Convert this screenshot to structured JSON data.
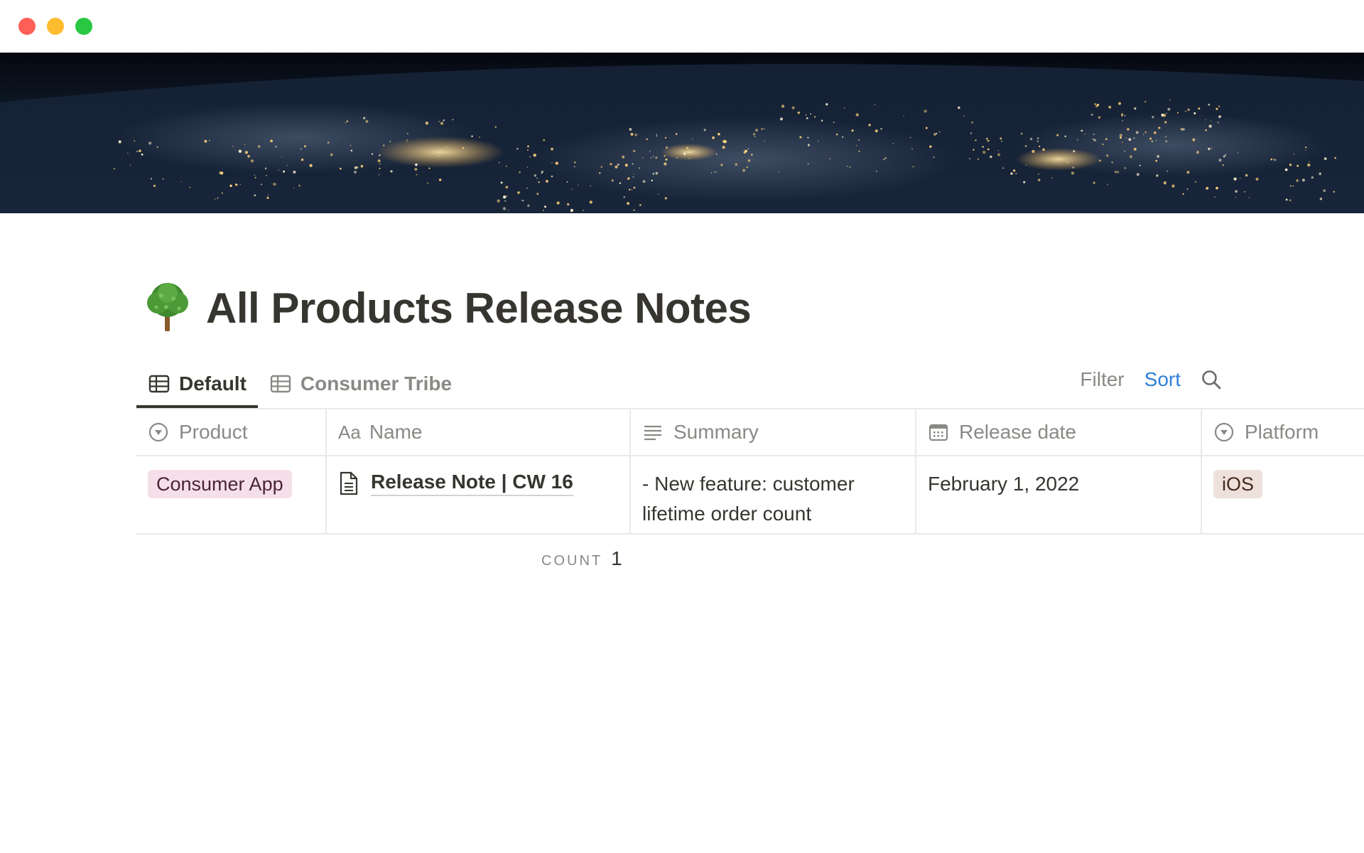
{
  "window": {
    "controls": {
      "close_color": "#ff5f57",
      "minimize_color": "#febc2e",
      "zoom_color": "#28c840"
    }
  },
  "cover": {
    "description_icon": "earth-at-night-cover-image"
  },
  "page": {
    "icon": "tree-emoji-icon",
    "title": "All Products Release Notes"
  },
  "views": {
    "tabs": [
      {
        "label": "Default",
        "icon": "table-icon",
        "active": true
      },
      {
        "label": "Consumer Tribe",
        "icon": "table-icon",
        "active": false
      }
    ],
    "toolbar": {
      "filter_label": "Filter",
      "sort_label": "Sort",
      "search_icon": "search-icon",
      "sort_color": "#2f7fd8"
    }
  },
  "table": {
    "columns": [
      {
        "label": "Product",
        "icon": "select-icon"
      },
      {
        "label": "Name",
        "icon": "text-aa-icon",
        "icon_text": "Aa"
      },
      {
        "label": "Summary",
        "icon": "text-lines-icon"
      },
      {
        "label": "Release date",
        "icon": "calendar-icon"
      },
      {
        "label": "Platform",
        "icon": "select-icon"
      }
    ],
    "rows": [
      {
        "product": "Consumer App",
        "product_color": "#f5e0e9",
        "name": "Release Note | CW 16",
        "summary": "- New feature: customer lifetime order count",
        "release_date": "February 1, 2022",
        "platform": "iOS",
        "platform_color": "#eee0da"
      }
    ],
    "footer": {
      "count_label": "COUNT",
      "count_value": "1"
    }
  }
}
